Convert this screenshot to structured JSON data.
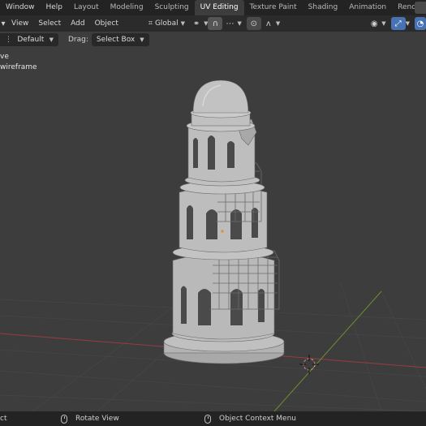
{
  "app_menu": {
    "window": "Window",
    "help": "Help"
  },
  "workspaces": [
    {
      "label": "Layout"
    },
    {
      "label": "Modeling"
    },
    {
      "label": "Sculpting"
    },
    {
      "label": "UV Editing"
    },
    {
      "label": "Texture Paint"
    },
    {
      "label": "Shading"
    },
    {
      "label": "Animation"
    },
    {
      "label": "Rendering"
    }
  ],
  "header": {
    "view": "View",
    "select": "Select",
    "add": "Add",
    "object": "Object",
    "transform_orientation": "Global"
  },
  "toolbar": {
    "orientation": "Default",
    "drag_label": "Drag:",
    "drag_value": "Select Box"
  },
  "viewport": {
    "overlay_line1": "ve",
    "overlay_line2": " wireframe"
  },
  "status": {
    "left": "ct",
    "middle": "Rotate View",
    "right": "Object Context Menu"
  },
  "colors": {
    "viewport_bg": "#3d3d3d",
    "active_tab_bg": "#3d3d3d",
    "accent_blue": "#4772b3",
    "x_axis": "#9b3a47",
    "y_axis": "#6c8f2f",
    "model": "#b8b8b8"
  },
  "icons": [
    "dropdown-arrow-icon",
    "transform-pivot-icon",
    "link-icon",
    "snap-icon",
    "snap-increment-icon",
    "proportional-editing-icon",
    "falloff-icon",
    "visibility-icon",
    "gizmo-icon",
    "overlay-icon",
    "mouse-left-icon",
    "mouse-middle-icon",
    "mouse-right-icon",
    "3d-cursor-icon"
  ]
}
